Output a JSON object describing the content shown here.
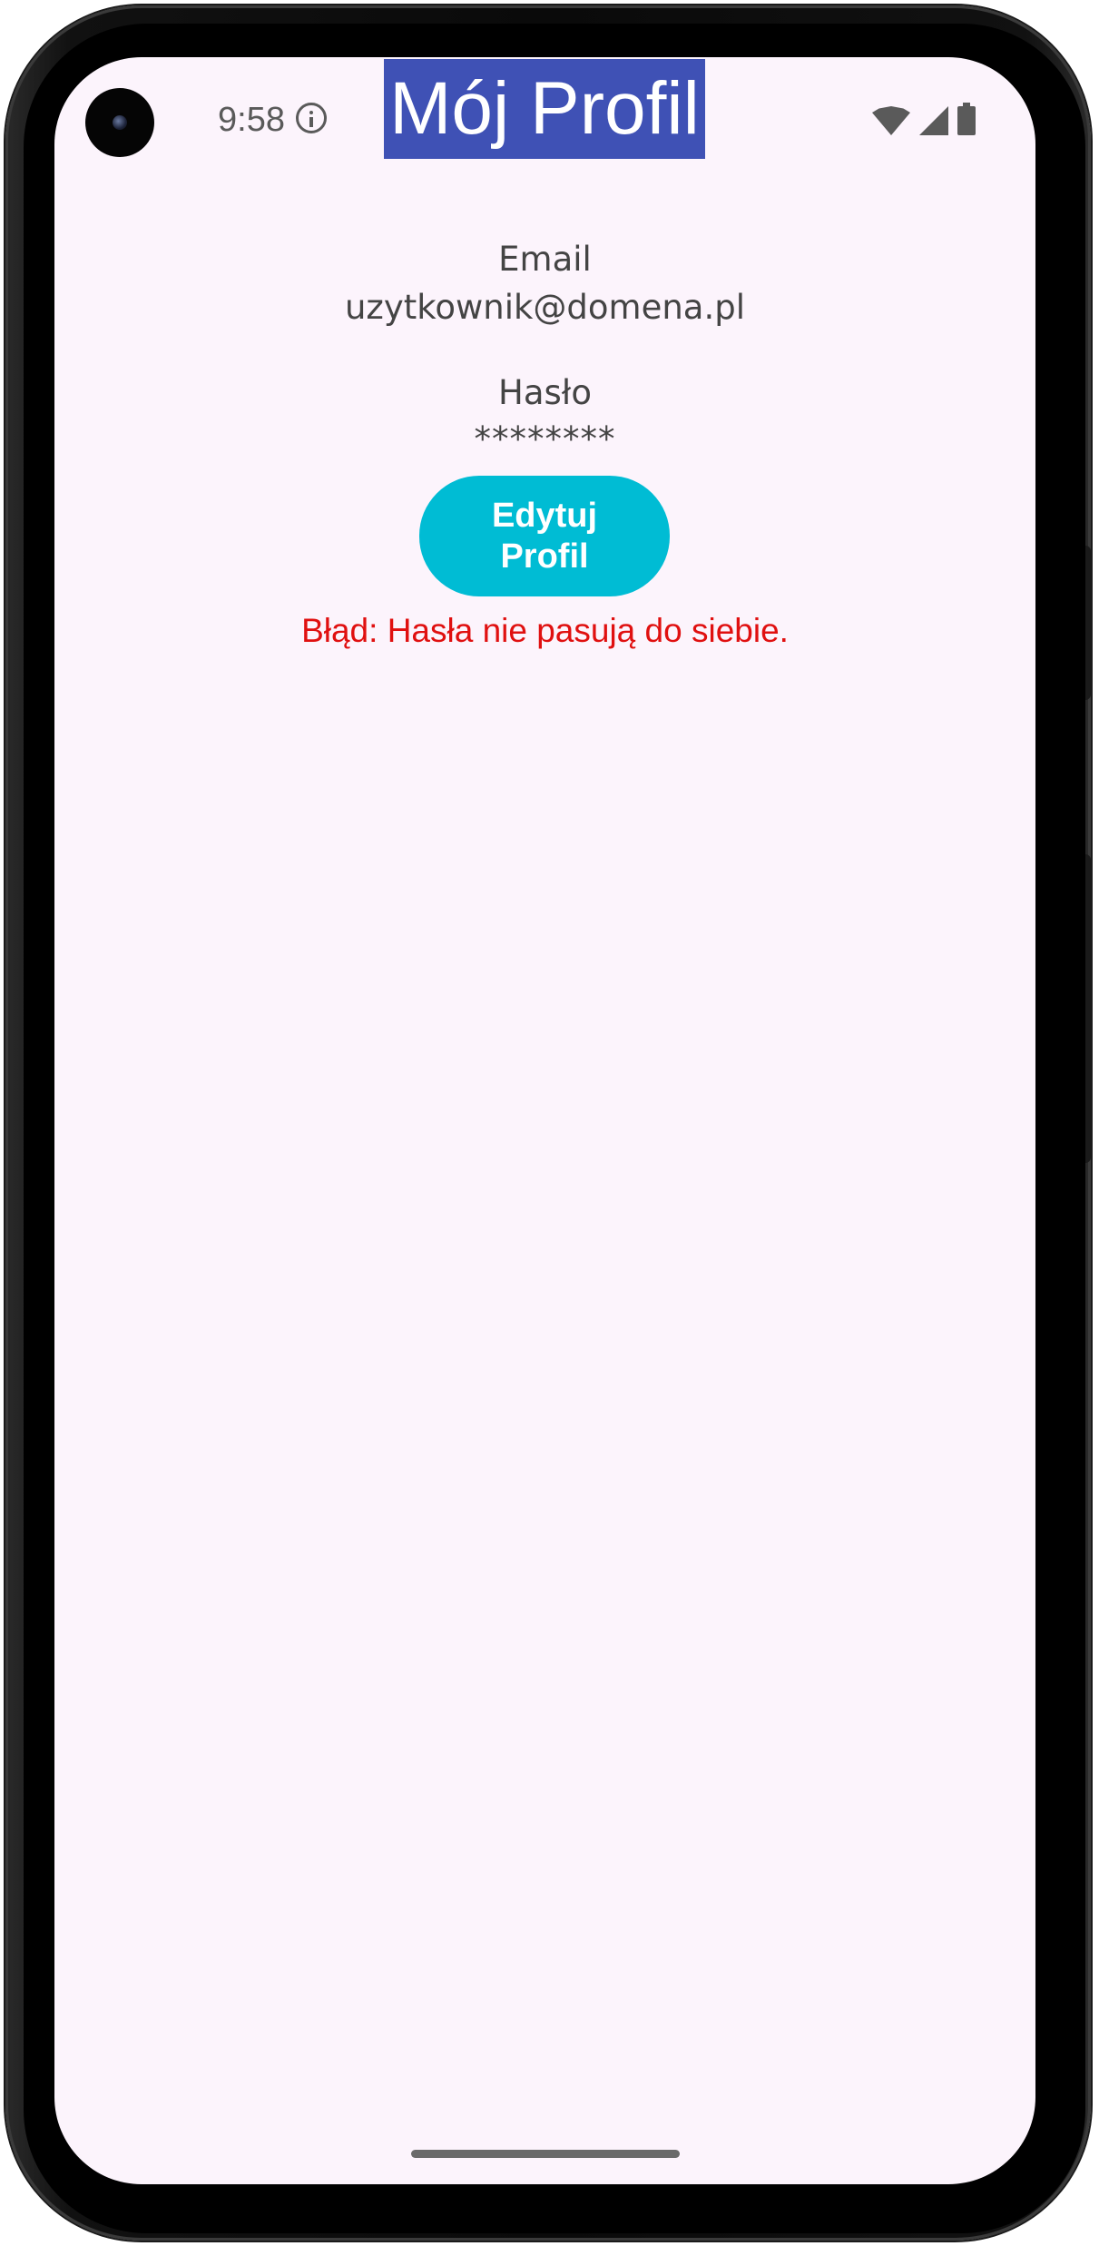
{
  "status_bar": {
    "time": "9:58",
    "icons": [
      "camera-icon",
      "info-icon",
      "wifi-icon",
      "signal-icon",
      "battery-icon"
    ]
  },
  "header": {
    "title": "Mój Profil",
    "background_color": "#3f51b5"
  },
  "profile": {
    "email_label": "Email",
    "email_value": "uzytkownik@domena.pl",
    "password_label": "Hasło",
    "password_value": "********"
  },
  "actions": {
    "edit_button_label": "Edytuj Profil",
    "edit_button_color": "#00bcd4"
  },
  "error": {
    "message": "Błąd: Hasła nie pasują do siebie.",
    "color": "#e01010"
  }
}
